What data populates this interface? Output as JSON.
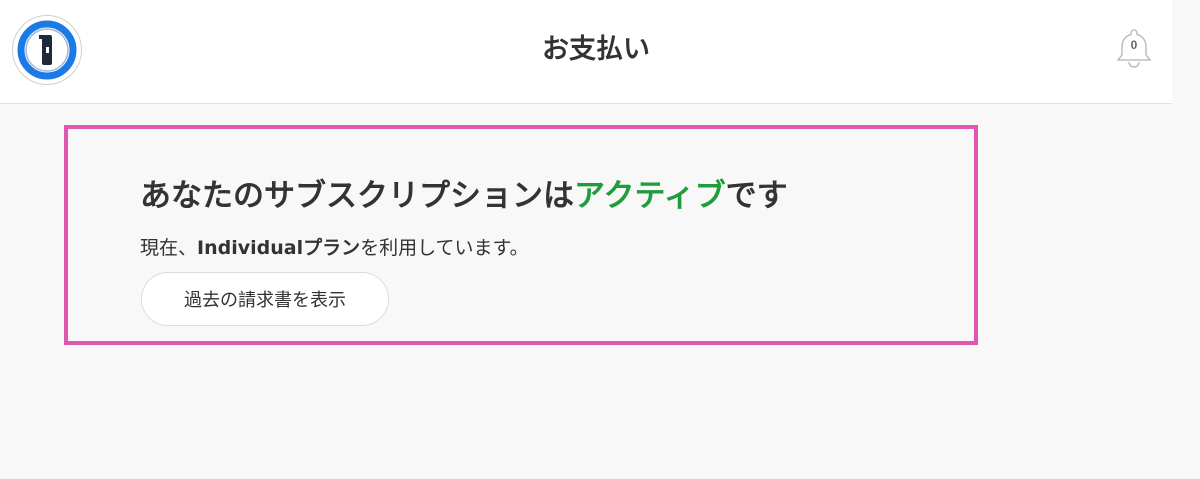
{
  "header": {
    "title": "お支払い",
    "notification_count": "0"
  },
  "subscription": {
    "heading_prefix": "あなたのサブスクリプションは",
    "status": "アクティブ",
    "heading_suffix": "です",
    "desc_prefix": "現在、",
    "plan_name": "Individualプラン",
    "desc_suffix": "を利用しています。",
    "history_button_label": "過去の請求書を表示"
  },
  "colors": {
    "accent_active": "#1f9d3a",
    "highlight_border": "#e057b0",
    "logo_blue": "#1a7be6"
  }
}
